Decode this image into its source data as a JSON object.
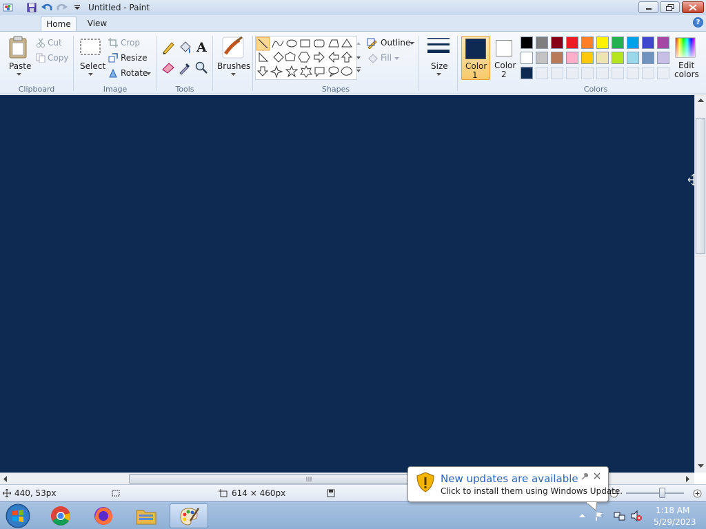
{
  "window": {
    "title": "Untitled - Paint"
  },
  "tabs": {
    "home": "Home",
    "view": "View"
  },
  "help": {
    "label": "?"
  },
  "clipboard": {
    "paste": "Paste",
    "cut": "Cut",
    "copy": "Copy",
    "group": "Clipboard"
  },
  "image": {
    "select": "Select",
    "crop": "Crop",
    "resize": "Resize",
    "rotate": "Rotate",
    "group": "Image"
  },
  "tools": {
    "group": "Tools",
    "text_glyph": "A"
  },
  "brushes": {
    "label": "Brushes"
  },
  "shapes": {
    "outline": "Outline",
    "fill": "Fill",
    "group": "Shapes"
  },
  "size": {
    "label": "Size"
  },
  "color1": {
    "line1": "Color",
    "line2": "1",
    "value": "#0d2b52"
  },
  "color2": {
    "line1": "Color",
    "line2": "2",
    "value": "#ffffff"
  },
  "colors": {
    "group": "Colors",
    "edit_line1": "Edit",
    "edit_line2": "colors",
    "row1": [
      "#000000",
      "#7f7f7f",
      "#880015",
      "#ed1c24",
      "#ff7f27",
      "#fff200",
      "#22b14c",
      "#00a2e8",
      "#3f48cc",
      "#a349a4"
    ],
    "row2": [
      "#ffffff",
      "#c3c3c3",
      "#b97a57",
      "#ffaec9",
      "#ffc90e",
      "#efe4b0",
      "#b5e61d",
      "#99d9ea",
      "#7092be",
      "#c8bfe7"
    ],
    "row3_custom": "#0d2b52"
  },
  "status": {
    "position": "440, 53px",
    "canvas_size": "614 × 460px"
  },
  "notification": {
    "title": "New updates are available",
    "body": "Click to install them using Windows Update."
  },
  "clock": {
    "time": "1:18 AM",
    "date": "5/29/2023"
  }
}
